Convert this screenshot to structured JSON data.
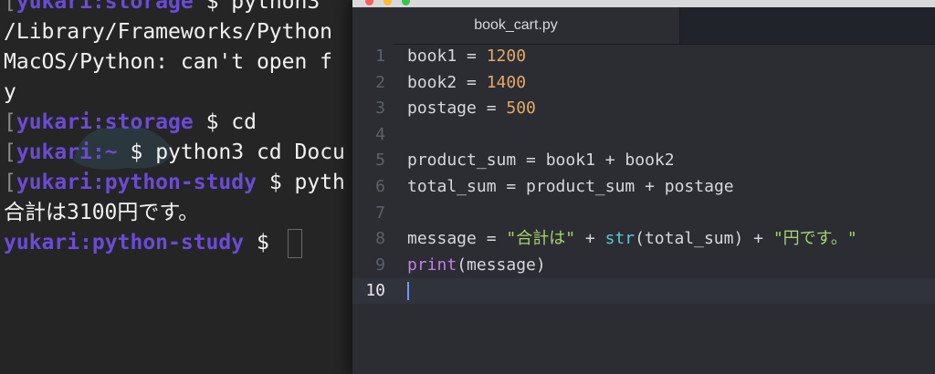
{
  "terminal": {
    "lines": [
      {
        "bracket": "[",
        "prompt": "yukari:storage",
        "dollar": " $ ",
        "text": "python3 "
      },
      {
        "text": "/Library/Frameworks/Python"
      },
      {
        "text": "MacOS/Python: can't open f"
      },
      {
        "text": "y"
      },
      {
        "bracket": "[",
        "prompt": "yukari:storage",
        "dollar": " $ ",
        "text": "cd"
      },
      {
        "bracket": "[",
        "prompt": "yukari:~",
        "dollar": " $ ",
        "text": "python3 cd Docu"
      },
      {
        "bracket": "[",
        "prompt": "yukari:python-study",
        "dollar": " $ ",
        "text": "pyth"
      },
      {
        "text": "合計は3100円です。"
      },
      {
        "prompt": "yukari:python-study",
        "dollar": " $ "
      }
    ],
    "colors": {
      "prompt": "#6b4bd6",
      "background": "#252525"
    }
  },
  "editor": {
    "tab_title": "book_cart.py",
    "lines": [
      {
        "number": "1",
        "code": [
          {
            "t": "book1 = "
          },
          {
            "t": "1200",
            "c": "num"
          }
        ]
      },
      {
        "number": "2",
        "code": [
          {
            "t": "book2 = "
          },
          {
            "t": "1400",
            "c": "num"
          }
        ]
      },
      {
        "number": "3",
        "code": [
          {
            "t": "postage = "
          },
          {
            "t": "500",
            "c": "num"
          }
        ]
      },
      {
        "number": "4",
        "code": []
      },
      {
        "number": "5",
        "code": [
          {
            "t": "product_sum = book1 + book2"
          }
        ]
      },
      {
        "number": "6",
        "code": [
          {
            "t": "total_sum = product_sum + postage"
          }
        ]
      },
      {
        "number": "7",
        "code": []
      },
      {
        "number": "8",
        "code": [
          {
            "t": "message = "
          },
          {
            "t": "\"合計は\"",
            "c": "str"
          },
          {
            "t": " + "
          },
          {
            "t": "str",
            "c": "fn"
          },
          {
            "t": "(total_sum) + "
          },
          {
            "t": "\"円です。\"",
            "c": "str"
          }
        ]
      },
      {
        "number": "9",
        "code": [
          {
            "t": "print",
            "c": "kw"
          },
          {
            "t": "(message)"
          }
        ]
      },
      {
        "number": "10",
        "code": [],
        "active": true
      }
    ],
    "colors": {
      "background": "#2b2d33",
      "number": "#e5a867",
      "string": "#a6d26a",
      "builtin": "#5fc6d6",
      "keyword": "#c27ee8"
    }
  }
}
